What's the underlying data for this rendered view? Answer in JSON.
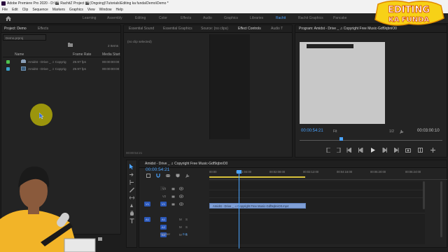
{
  "app": {
    "title": "Adobe Premiere Pro 2020 - D:\\🎬 RachitZ Project 🎬(Ongoing)\\Tutorials\\Editing ka funda\\Demo\\Demo *"
  },
  "menu": [
    "File",
    "Edit",
    "Clip",
    "Sequence",
    "Markers",
    "Graphics",
    "View",
    "Window",
    "Help"
  ],
  "workspaces": [
    {
      "label": "Learning",
      "active": false
    },
    {
      "label": "Assembly",
      "active": false
    },
    {
      "label": "Editing",
      "active": false
    },
    {
      "label": "Color",
      "active": false
    },
    {
      "label": "Effects",
      "active": false
    },
    {
      "label": "Audio",
      "active": false
    },
    {
      "label": "Graphics",
      "active": false
    },
    {
      "label": "Libraries",
      "active": false
    },
    {
      "label": "Rachit",
      "active": true
    },
    {
      "label": "Rachit Graphics",
      "active": false
    },
    {
      "label": "Pancake",
      "active": false
    }
  ],
  "logo": {
    "line1": "EDITING",
    "line2": "KA FUNDA"
  },
  "project": {
    "tabs": [
      "Project: Demo",
      "Effects"
    ],
    "bin": "Demo.prproj",
    "item_count": "2 Items",
    "columns": [
      "Name",
      "Frame Rate",
      "Media Start"
    ],
    "rows": [
      {
        "name": "Amidst - Drive _ ♫ Copyrig",
        "fps": "29.97 fps",
        "start": "00:00:00:00",
        "color": "#4ec24e"
      },
      {
        "name": "Amidst - Drive _ ♫ Copyrig",
        "fps": "29.97 fps",
        "start": "00:00:00:00",
        "color": "#3aa0c8"
      }
    ]
  },
  "center_panel": {
    "tabs": [
      "Essential Sound",
      "Essential Graphics",
      "Source: (no clips)",
      "Effect Controls",
      "Audio T"
    ],
    "no_clip": "(no clip selected)",
    "timecode": "00:00:54:21"
  },
  "program": {
    "title": "Program: Amidst - Drive _ ♫ Copyright Free Music-Gdf9qbniO0",
    "timecode": "00:00:54:21",
    "fit": "Fit",
    "resolution": "1/2",
    "duration": "00:03:00:10"
  },
  "timeline": {
    "sequence_title": "Amidst - Drive _ ♫ Copyright Free Music-Gdf9qbniO0",
    "timecode": "00:00:54:21",
    "ruler": [
      "00:00",
      "00:01:04:00",
      "00:02:08:00",
      "00:03:12:00",
      "00:04:16:00",
      "00:05:20:00",
      "00:06:24:00"
    ],
    "tracks": [
      {
        "label": "V3",
        "kind": "video"
      },
      {
        "label": "V2",
        "kind": "video"
      },
      {
        "label": "V1",
        "kind": "video"
      },
      {
        "label": "A1",
        "kind": "audio"
      },
      {
        "label": "A2",
        "kind": "audio"
      },
      {
        "label": "A3",
        "kind": "audio"
      }
    ],
    "clip_label": "Amidst - Drive _ ♫ Copyright Free Music-Gdf9qbniO0.mp4",
    "mix_label": "Master",
    "mix_value": "0.0"
  },
  "colors": {
    "accent": "#4aa3ff",
    "clip": "#7f9fd6",
    "playhead": "#4aa3ff"
  }
}
